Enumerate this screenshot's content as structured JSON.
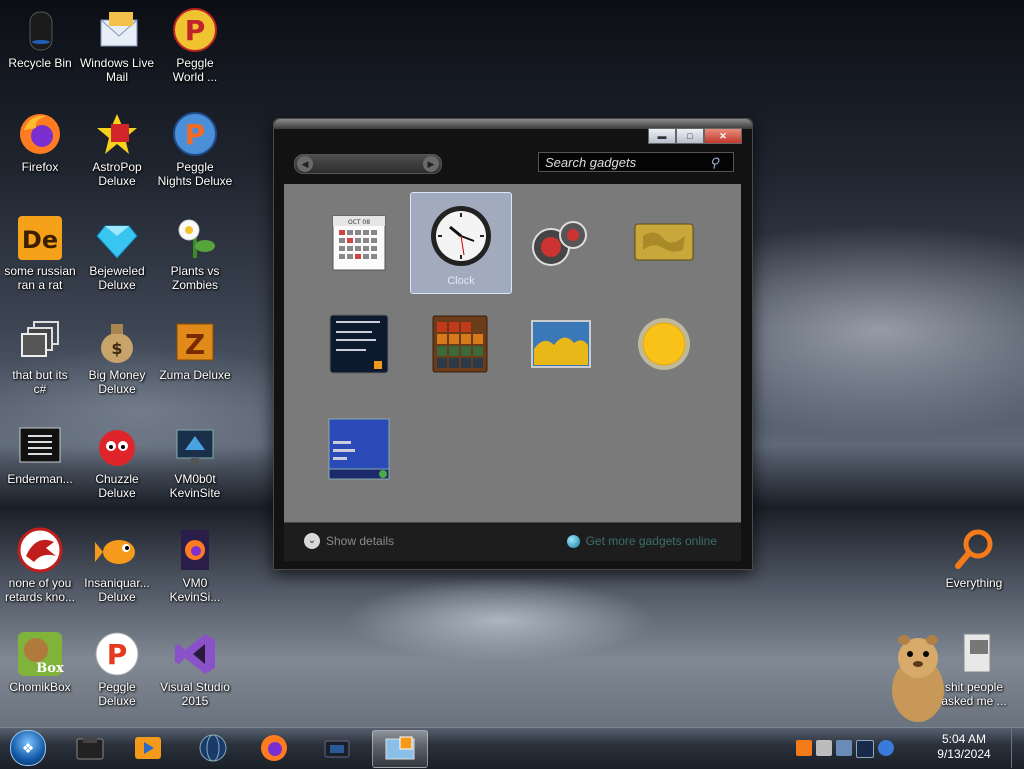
{
  "desktop": {
    "icons": [
      {
        "label": "Recycle Bin",
        "icon": "recycle-bin-icon"
      },
      {
        "label": "Windows Live\nMail",
        "icon": "mail-icon"
      },
      {
        "label": "Peggle\nWorld ...",
        "icon": "peggle-icon"
      },
      {
        "label": "Firefox",
        "icon": "firefox-icon"
      },
      {
        "label": "AstroPop\nDeluxe",
        "icon": "astropop-icon"
      },
      {
        "label": "Peggle\nNights Deluxe",
        "icon": "peggle-nights-icon"
      },
      {
        "label": "some russian\nran a rat",
        "icon": "de-icon"
      },
      {
        "label": "Bejeweled\nDeluxe",
        "icon": "gem-icon"
      },
      {
        "label": "Plants vs\nZombies",
        "icon": "plant-icon"
      },
      {
        "label": "that but its\nc#",
        "icon": "stack-icon"
      },
      {
        "label": "Big Money\nDeluxe",
        "icon": "money-bag-icon"
      },
      {
        "label": "Zuma Deluxe",
        "icon": "zuma-icon"
      },
      {
        "label": "Enderman...",
        "icon": "console-icon"
      },
      {
        "label": "Chuzzle\nDeluxe",
        "icon": "chuzzle-icon"
      },
      {
        "label": "VM0b0t\nKevinSite",
        "icon": "monitor-icon"
      },
      {
        "label": "none of you\nretards kno...",
        "icon": "red-dragon-icon"
      },
      {
        "label": "Insaniquar...\nDeluxe",
        "icon": "fish-icon"
      },
      {
        "label": "VM0\nKevinSi...",
        "icon": "firefox-file-icon"
      },
      {
        "label": "ChomikBox",
        "icon": "chomikbox-icon"
      },
      {
        "label": "Peggle\nDeluxe",
        "icon": "peggle-deluxe-icon"
      },
      {
        "label": "Visual Studio\n2015",
        "icon": "visual-studio-icon"
      },
      {
        "label": "Everything",
        "icon": "magnifier-icon"
      },
      {
        "label": "shit people\nasked me ...",
        "icon": "folder-icon"
      }
    ]
  },
  "gallery": {
    "search_placeholder": "Search gadgets",
    "selected_gadget_name": "Clock",
    "gadgets": [
      "calendar-gadget",
      "clock-gadget",
      "cpu-meter-gadget",
      "currency-gadget",
      "feed-headlines-gadget",
      "picture-puzzle-gadget",
      "slide-show-gadget",
      "weather-gadget",
      "media-center-gadget"
    ],
    "calendar_month": "OCT 08",
    "show_details": "Show details",
    "get_more": "Get more gadgets online"
  },
  "taskbar": {
    "clock_time": "5:04 AM",
    "clock_date": "9/13/2024",
    "items": [
      "explorer",
      "media-player",
      "network",
      "firefox",
      "vm-console",
      "gadget-gallery"
    ]
  },
  "colors": {
    "accent": "#135aa8",
    "window_bg": "#121212",
    "gallery_bg": "#7a7a7a"
  }
}
